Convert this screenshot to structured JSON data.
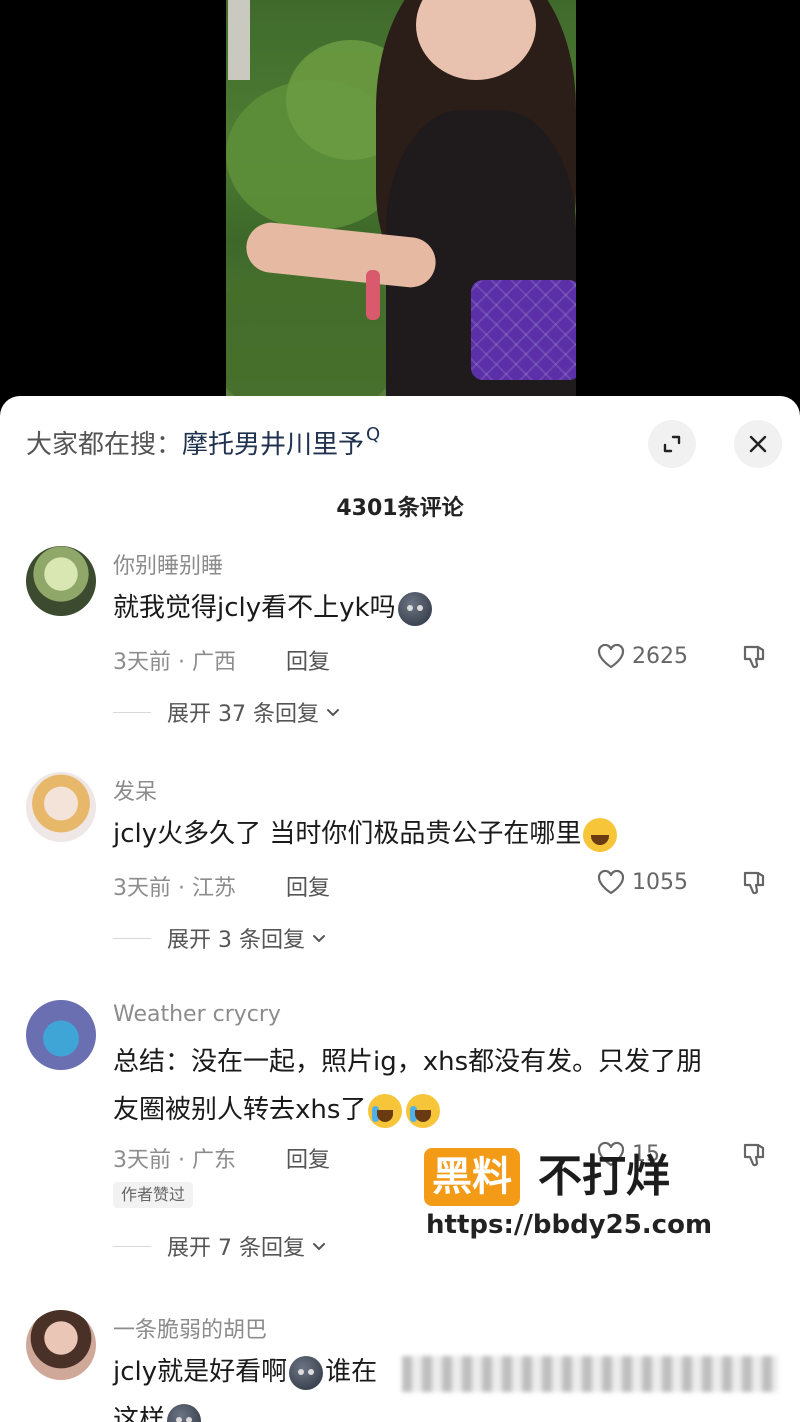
{
  "search": {
    "prefix": "大家都在搜：",
    "term": "摩托男井川里予",
    "glyph": "Q"
  },
  "comments_count": "4301条评论",
  "comments": [
    {
      "username": "你别睡别睡",
      "text": "就我觉得jcly看不上yk吗",
      "emoji_after": "grey-blob-emoji",
      "meta": "3天前 · 广西",
      "reply": "回复",
      "likes": "2625",
      "expand": "展开 37 条回复"
    },
    {
      "username": "发呆",
      "text": "jcly火多久了 当时你们极品贵公子在哪里",
      "emoji_after": "laughing-tears-emoji",
      "meta": "3天前 · 江苏",
      "reply": "回复",
      "likes": "1055",
      "expand": "展开 3 条回复"
    },
    {
      "username": "Weather crycry",
      "text_line1": "总结：没在一起，照片ig，xhs都没有发。只发了朋",
      "text_line2": "友圈被别人转去xhs了",
      "emoji_after": "crying-laughing-emoji",
      "meta": "3天前 · 广东",
      "reply": "回复",
      "likes": "15",
      "badge": "作者赞过",
      "expand": "展开 7 条回复"
    },
    {
      "username": "一条脆弱的胡巴",
      "text_start": "jcly就是好看啊",
      "text_mid": "谁在",
      "text_line2": "这样",
      "emoji_after": "grey-blob-emoji"
    }
  ],
  "watermark": {
    "box": "黑料",
    "rest": "不打烊",
    "url": "https://bbdy25.com"
  }
}
